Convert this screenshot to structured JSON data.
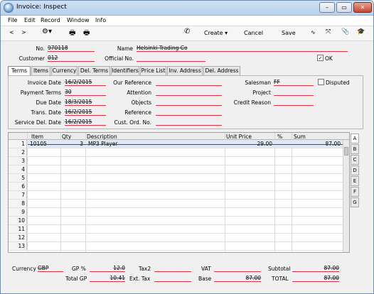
{
  "window": {
    "title": "Invoice: Inspect"
  },
  "menu": {
    "file": "File",
    "edit": "Edit",
    "record": "Record",
    "window": "Window",
    "info": "Info"
  },
  "toolbar": {
    "create": "Create",
    "cancel": "Cancel",
    "save": "Save"
  },
  "header": {
    "no_label": "No.",
    "no_value": "970118",
    "name_label": "Name",
    "name_value": "Helsinki Trading Co",
    "customer_label": "Customer",
    "customer_value": "012",
    "official_label": "Official No.",
    "official_value": "",
    "ok_label": "OK",
    "ok_checked": "✓"
  },
  "tabs": [
    "Terms",
    "Items",
    "Currency",
    "Del. Terms",
    "Identifiers",
    "Price List",
    "Inv. Address",
    "Del. Address"
  ],
  "terms": {
    "invoice_date_label": "Invoice Date",
    "invoice_date": "16/2/2015",
    "payment_terms_label": "Payment Terms",
    "payment_terms": "30",
    "due_date_label": "Due Date",
    "due_date": "18/3/2015",
    "trans_date_label": "Trans. Date",
    "trans_date": "16/2/2015",
    "service_del_label": "Service Del. Date",
    "service_del": "16/2/2015",
    "our_ref_label": "Our Reference",
    "attention_label": "Attention",
    "objects_label": "Objects",
    "reference_label": "Reference",
    "cust_ord_label": "Cust. Ord. No.",
    "salesman_label": "Salesman",
    "salesman": "FF",
    "disputed_label": "Disputed",
    "project_label": "Project",
    "credit_reason_label": "Credit Reason"
  },
  "grid": {
    "columns": [
      "Item",
      "Qty",
      "Description",
      "Unit Price",
      "%",
      "Sum"
    ],
    "rows": [
      {
        "n": "1",
        "item": "10105",
        "qty": "3",
        "desc": "MP3 Player",
        "price": "29.00",
        "pct": "",
        "sum": "87.00"
      },
      {
        "n": "2"
      },
      {
        "n": "3"
      },
      {
        "n": "4"
      },
      {
        "n": "5"
      },
      {
        "n": "6"
      },
      {
        "n": "7"
      },
      {
        "n": "8"
      },
      {
        "n": "9"
      },
      {
        "n": "10"
      },
      {
        "n": "11"
      },
      {
        "n": "12"
      },
      {
        "n": "13"
      }
    ],
    "side_tabs": [
      "A",
      "B",
      "C",
      "D",
      "E",
      "F",
      "G"
    ]
  },
  "footer": {
    "currency_label": "Currency",
    "currency": "GBP",
    "gp_pct_label": "GP %",
    "gp_pct": "12.0",
    "tax2_label": "Tax2",
    "vat_label": "VAT",
    "subtotal_label": "Subtotal",
    "subtotal": "87.00",
    "total_gp_label": "Total GP",
    "total_gp": "10.41",
    "ext_tax_label": "Ext. Tax",
    "base_label": "Base",
    "base": "87.00",
    "total_label": "TOTAL",
    "total": "87.00"
  }
}
